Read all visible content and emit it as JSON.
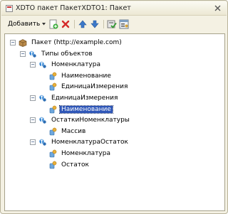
{
  "window": {
    "title": "XDTO пакет ПакетXDTO1: Пакет"
  },
  "toolbar": {
    "add_label": "Добавить",
    "icons": [
      "add-icon",
      "delete-icon",
      "move-up-icon",
      "move-down-icon",
      "check-icon",
      "settings-icon"
    ]
  },
  "tree": {
    "items": [
      {
        "label": "Пакет (http://example.com)",
        "level": 0,
        "toggle": "−",
        "icon": "package-icon"
      },
      {
        "label": "Типы объектов",
        "level": 1,
        "toggle": "−",
        "icon": "type-icon"
      },
      {
        "label": "Номенклатура",
        "level": 2,
        "toggle": "−",
        "icon": "type-icon"
      },
      {
        "label": "Наименование",
        "level": 3,
        "toggle": "",
        "icon": "property-icon"
      },
      {
        "label": "ЕдиницаИзмерения",
        "level": 3,
        "toggle": "",
        "icon": "property-icon"
      },
      {
        "label": "ЕдиницаИзмерения",
        "level": 2,
        "toggle": "−",
        "icon": "type-icon"
      },
      {
        "label": "Наименование",
        "level": 3,
        "toggle": "",
        "icon": "property-icon",
        "selected": true
      },
      {
        "label": "ОстаткиНоменклатуры",
        "level": 2,
        "toggle": "−",
        "icon": "type-icon"
      },
      {
        "label": "Массив",
        "level": 3,
        "toggle": "",
        "icon": "property-icon"
      },
      {
        "label": "НоменклатураОстаток",
        "level": 2,
        "toggle": "−",
        "icon": "type-icon"
      },
      {
        "label": "Номенклатура",
        "level": 3,
        "toggle": "",
        "icon": "property-icon"
      },
      {
        "label": "Остаток",
        "level": 3,
        "toggle": "",
        "icon": "property-icon"
      }
    ]
  }
}
